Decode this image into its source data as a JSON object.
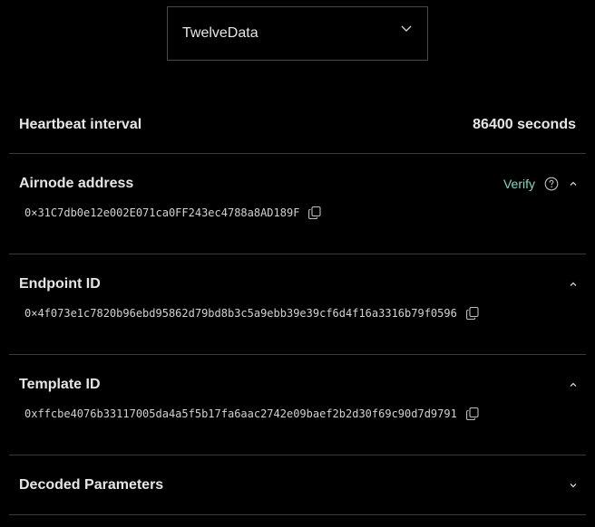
{
  "provider": {
    "selected": "TwelveData",
    "icon": "chevron-down-icon"
  },
  "heartbeat": {
    "label": "Heartbeat interval",
    "value": "86400 seconds"
  },
  "sections": {
    "airnode": {
      "title": "Airnode address",
      "verify_label": "Verify",
      "value": "0×31C7db0e12e002E071ca0FF243ec4788a8AD189F"
    },
    "endpoint": {
      "title": "Endpoint ID",
      "value": "0×4f073e1c7820b96ebd95862d79bd8b3c5a9ebb39e39cf6d4f16a3316b79f0596"
    },
    "template": {
      "title": "Template ID",
      "value": "0xffcbe4076b33117005da4a5f5b17fa6aac2742e09baef2b2d30f69c90d7d9791"
    },
    "decoded": {
      "title": "Decoded Parameters"
    }
  },
  "colors": {
    "background": "#000000",
    "text": "#e6e6e6",
    "accent": "#7dd9c4",
    "divider": "#3a3a3a"
  }
}
